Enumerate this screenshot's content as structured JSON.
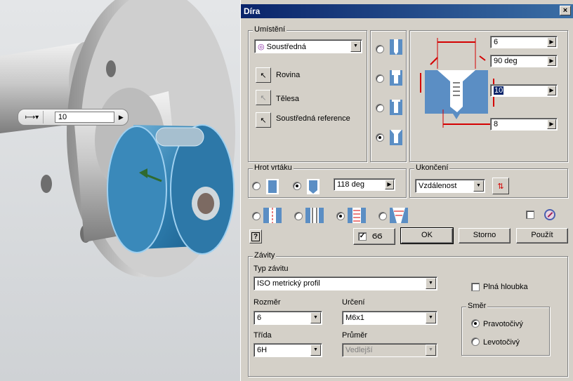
{
  "viewport": {
    "mini_toolbar": {
      "value": "10"
    }
  },
  "dialog": {
    "title": "Díra",
    "close_label": "×",
    "placement": {
      "title": "Umístění",
      "type_value": "Soustředná",
      "rows": [
        "Rovina",
        "Tělesa",
        "Soustředná reference"
      ]
    },
    "dims": {
      "top_value": "6",
      "angle_value": "90 deg",
      "depth_value": "10",
      "bottom_value": "8"
    },
    "drill_point": {
      "title": "Hrot vrtáku",
      "angle_value": "118 deg"
    },
    "termination": {
      "title": "Ukončení",
      "value": "Vzdálenost"
    },
    "buttons": {
      "help": "?",
      "ok": "OK",
      "cancel": "Storno",
      "apply": "Použít"
    },
    "threads": {
      "title": "Závity",
      "thread_type_label": "Typ závitu",
      "thread_type_value": "ISO metrický profil",
      "full_depth_label": "Plná hloubka",
      "size_label": "Rozměr",
      "size_value": "6",
      "designation_label": "Určení",
      "designation_value": "M6x1",
      "class_label": "Třída",
      "class_value": "6H",
      "diameter_label": "Průměr",
      "diameter_value": "Vedlejší",
      "direction": {
        "title": "Směr",
        "right": "Pravotočivý",
        "left": "Levotočivý"
      }
    }
  },
  "colors": {
    "titlebar": "#0a246a",
    "dim_red": "#d40000",
    "hole_blue": "#5b8ec4",
    "selected_part": "#2f7fb0"
  }
}
